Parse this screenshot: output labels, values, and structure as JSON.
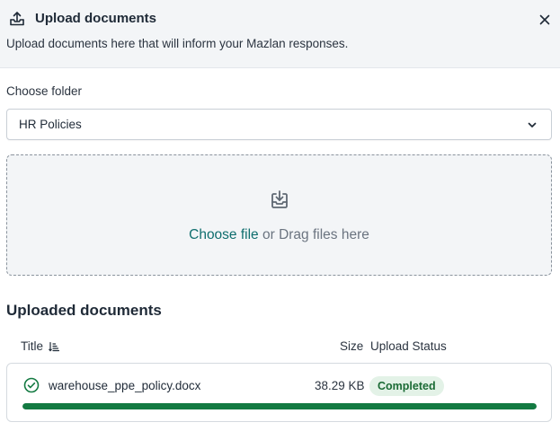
{
  "header": {
    "title": "Upload documents",
    "subtitle": "Upload documents here that will inform your Mazlan responses.",
    "upload_icon": "upload-tray-icon",
    "close_icon": "close-icon"
  },
  "folder": {
    "label": "Choose folder",
    "selected": "HR Policies",
    "dropdown_icon": "chevron-down-icon"
  },
  "dropzone": {
    "icon": "download-tray-icon",
    "link_text": "Choose file",
    "rest_text": " or Drag files here"
  },
  "uploaded": {
    "section_title": "Uploaded documents",
    "columns": {
      "title": "Title",
      "size": "Size",
      "status": "Upload Status"
    },
    "sort_icon": "sort-icon",
    "documents": [
      {
        "name": "warehouse_ppe_policy.docx",
        "size": "38.29 KB",
        "status": "Completed",
        "progress_percent": 100,
        "icon": "check-circle-icon"
      }
    ]
  },
  "colors": {
    "accent": "#0f6e6e",
    "success": "#137a42",
    "badge_bg": "#e3f2e7",
    "badge_text": "#1b6b35",
    "header_bg": "#f3f5f7"
  }
}
